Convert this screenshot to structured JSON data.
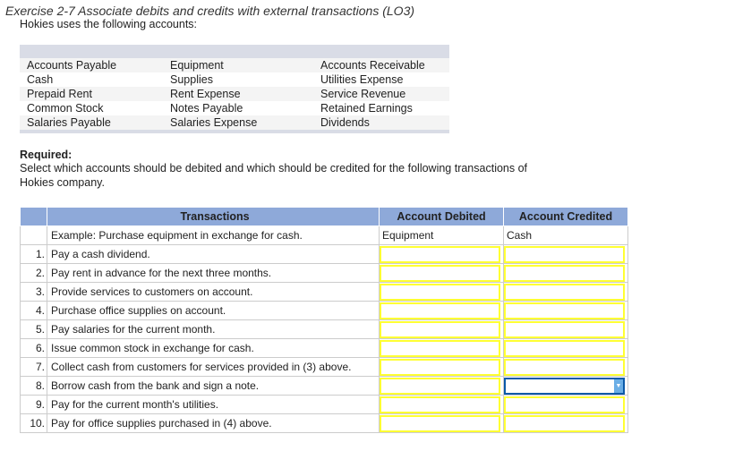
{
  "title": "Exercise 2-7 Associate debits and credits with external transactions (LO3)",
  "intro": "Hokies uses the following accounts:",
  "accounts": [
    [
      "Accounts Payable",
      "Equipment",
      "Accounts Receivable"
    ],
    [
      "Cash",
      "Supplies",
      "Utilities Expense"
    ],
    [
      "Prepaid Rent",
      "Rent Expense",
      "Service Revenue"
    ],
    [
      "Common Stock",
      "Notes Payable",
      "Retained Earnings"
    ],
    [
      "Salaries Payable",
      "Salaries Expense",
      "Dividends"
    ]
  ],
  "required": {
    "heading": "Required:",
    "text": "Select which accounts should be debited and which should be credited for the following transactions of Hokies company."
  },
  "table": {
    "headers": [
      "Transactions",
      "Account Debited",
      "Account Credited"
    ],
    "example": {
      "text": "Example: Purchase equipment in exchange for cash.",
      "debit": "Equipment",
      "credit": "Cash"
    },
    "rows": [
      {
        "n": "1.",
        "t": "Pay a cash dividend."
      },
      {
        "n": "2.",
        "t": "Pay rent in advance for the next three months."
      },
      {
        "n": "3.",
        "t": "Provide services to customers on account."
      },
      {
        "n": "4.",
        "t": "Purchase office supplies on account."
      },
      {
        "n": "5.",
        "t": "Pay salaries for the current month."
      },
      {
        "n": "6.",
        "t": "Issue common stock in exchange for cash."
      },
      {
        "n": "7.",
        "t": "Collect cash from customers for services provided in (3) above."
      },
      {
        "n": "8.",
        "t": "Borrow cash from the bank and sign a note."
      },
      {
        "n": "9.",
        "t": "Pay for the current month's utilities."
      },
      {
        "n": "10.",
        "t": "Pay for office supplies purchased in (4) above."
      }
    ]
  }
}
